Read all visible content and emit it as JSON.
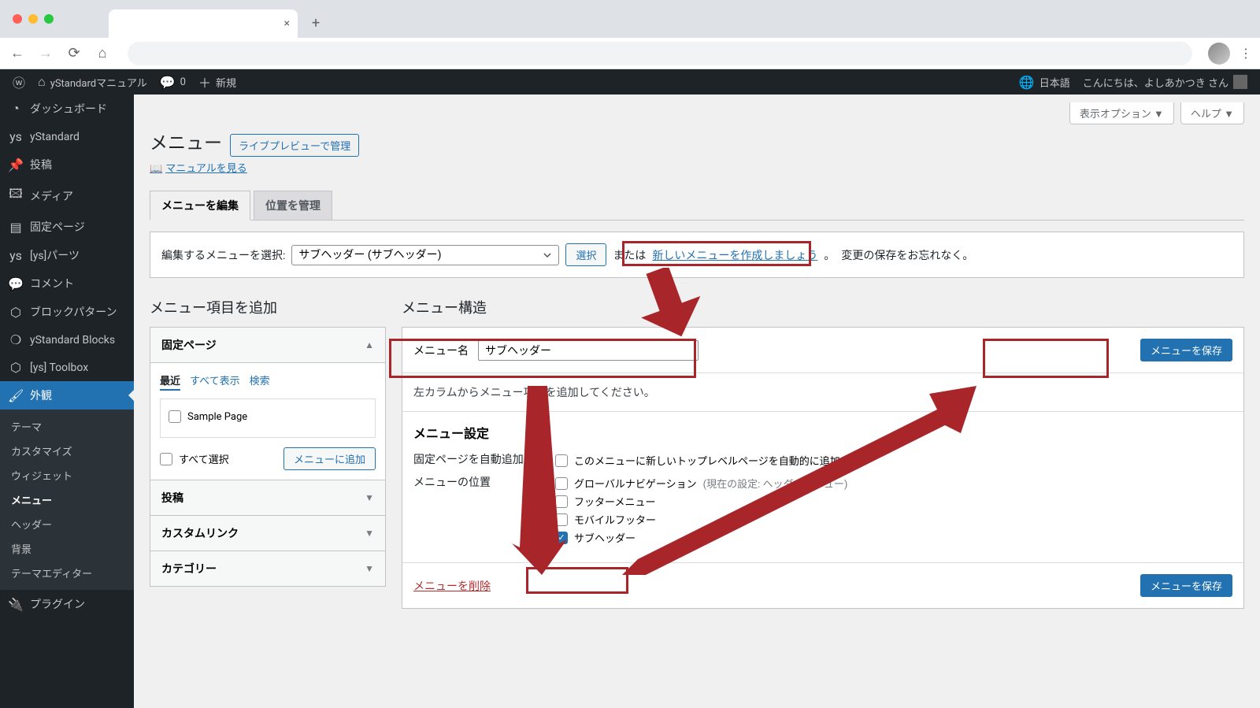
{
  "browser": {
    "new_tab": "+"
  },
  "adminbar": {
    "site_name": "yStandardマニュアル",
    "comments": "0",
    "new": "新規",
    "lang": "日本語",
    "greeting": "こんにちは、よしあかつき さん"
  },
  "sidebar": {
    "dashboard": "ダッシュボード",
    "ystandard": "yStandard",
    "posts": "投稿",
    "media": "メディア",
    "pages": "固定ページ",
    "ys_parts": "[ys]パーツ",
    "comments": "コメント",
    "block_patterns": "ブロックパターン",
    "ys_blocks": "yStandard Blocks",
    "ys_toolbox": "[ys] Toolbox",
    "appearance": "外観",
    "plugins": "プラグイン",
    "submenu": {
      "themes": "テーマ",
      "customize": "カスタマイズ",
      "widgets": "ウィジェット",
      "menus": "メニュー",
      "header": "ヘッダー",
      "background": "背景",
      "theme_editor": "テーマエディター"
    }
  },
  "screen_meta": {
    "options": "表示オプション ▼",
    "help": "ヘルプ ▼"
  },
  "header": {
    "title": "メニュー",
    "live_preview": "ライブプレビューで管理",
    "manual_link": "マニュアルを見る"
  },
  "tabs": {
    "edit": "メニューを編集",
    "locations": "位置を管理"
  },
  "manage": {
    "label": "編集するメニューを選択:",
    "selected": "サブヘッダー (サブヘッダー)",
    "select_btn": "選択",
    "or": "または",
    "create_link": "新しいメニューを作成しましょう",
    "period": "。",
    "reminder": "変更の保存をお忘れなく。"
  },
  "left": {
    "heading": "メニュー項目を追加",
    "pages": "固定ページ",
    "posts": "投稿",
    "custom_links": "カスタムリンク",
    "categories": "カテゴリー",
    "tab_recent": "最近",
    "tab_all": "すべて表示",
    "tab_search": "検索",
    "sample_page": "Sample Page",
    "select_all": "すべて選択",
    "add_to_menu": "メニューに追加"
  },
  "right": {
    "heading": "メニュー構造",
    "name_label": "メニュー名",
    "name_value": "サブヘッダー",
    "save": "メニューを保存",
    "empty_msg": "左カラムからメニュー項目を追加してください。",
    "settings_heading": "メニュー設定",
    "auto_add_label": "固定ページを自動追加",
    "auto_add_text": "このメニューに新しいトップレベルページを自動的に追加",
    "location_label": "メニューの位置",
    "loc_global": "グローバルナビゲーション",
    "loc_global_hint": "(現在の設定: ヘッダーメニュー)",
    "loc_footer": "フッターメニュー",
    "loc_mobile": "モバイルフッター",
    "loc_sub": "サブヘッダー",
    "delete": "メニューを削除",
    "save2": "メニューを保存"
  }
}
